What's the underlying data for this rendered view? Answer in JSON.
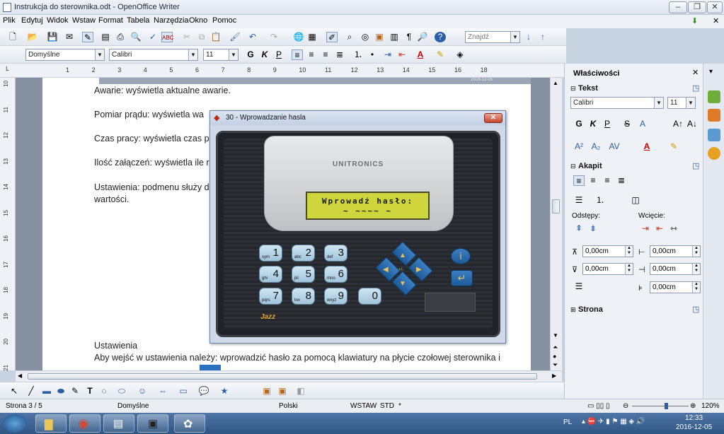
{
  "window": {
    "title": "Instrukcja do sterownika.odt - OpenOffice Writer"
  },
  "menu": [
    "Plik",
    "Edytuj",
    "Widok",
    "Wstaw",
    "Format",
    "Tabela",
    "Narzędzia",
    "Okno",
    "Pomoc"
  ],
  "toolbar": {
    "find_placeholder": "Znajdź"
  },
  "formatting": {
    "style": "Domyślne",
    "font": "Calibri",
    "size": "11",
    "bold": "G",
    "italic": "K",
    "underline": "P"
  },
  "ruler": {
    "marks": [
      "1",
      "2",
      "3",
      "4",
      "5",
      "6",
      "7",
      "8",
      "9",
      "10",
      "11",
      "12",
      "13",
      "14",
      "15",
      "16",
      "18"
    ]
  },
  "vruler": {
    "marks": [
      "10",
      "11",
      "12",
      "13",
      "14",
      "15",
      "16",
      "17",
      "18",
      "19",
      "20",
      "21"
    ]
  },
  "document": {
    "lines": [
      "Awarie: wyświetla aktualne awarie.",
      "Pomiar prądu: wyświetla wa",
      "Czas pracy: wyświetla czas pr",
      "Ilość załączeń: wyświetla ile r",
      "Ustawienia: podmenu służy d",
      "wartości.",
      "Ustawienia",
      "Aby wejść w ustawienia należy: wprowadzić hasło za pomocą klawiatury na płycie czołowej sterownika i"
    ],
    "embedded_date": "2016-12-05"
  },
  "dialog": {
    "title": "30 - Wprowadzanie hasla",
    "brand": "UNITRONICS",
    "lcd_line1": "Wprowadź hasło:",
    "lcd_line2": "~   ~~~~   ~",
    "model": "Jazz",
    "keys": [
      {
        "sub": "sym",
        "num": "1"
      },
      {
        "sub": "abc",
        "num": "2"
      },
      {
        "sub": "def",
        "num": "3"
      },
      {
        "sub": "ghi",
        "num": "4"
      },
      {
        "sub": "jkl",
        "num": "5"
      },
      {
        "sub": "mno",
        "num": "6"
      },
      {
        "sub": "pqrs",
        "num": "7"
      },
      {
        "sub": "tuv",
        "num": "8"
      },
      {
        "sub": "wxyz",
        "num": "9"
      },
      {
        "sub": "",
        "num": "0"
      }
    ],
    "info_key": "i",
    "enter_key": "↵",
    "nav_center": "+/-"
  },
  "sidebar": {
    "title": "Właściwości",
    "text_section": "Tekst",
    "font": "Calibri",
    "size": "11",
    "bold": "G",
    "italic": "K",
    "underline": "P",
    "paragraph_section": "Akapit",
    "spacing_label": "Odstępy:",
    "indent_label": "Wcięcie:",
    "spacing_above": "0,00cm",
    "spacing_below": "0,00cm",
    "indent_before": "0,00cm",
    "indent_after": "0,00cm",
    "indent_first": "0,00cm",
    "page_section": "Strona"
  },
  "status": {
    "page": "Strona  3 / 5",
    "style": "Domyślne",
    "language": "Polski",
    "insert_mode": "WSTAW",
    "selection_mode": "STD",
    "modified": "*",
    "zoom": "120%",
    "zoom_level": 0.6
  },
  "taskbar": {
    "language": "PL",
    "time": "12:33",
    "date": "2016-12-05"
  },
  "colors": {
    "accent": "#2f5583",
    "lcd": "#cfd53c"
  }
}
